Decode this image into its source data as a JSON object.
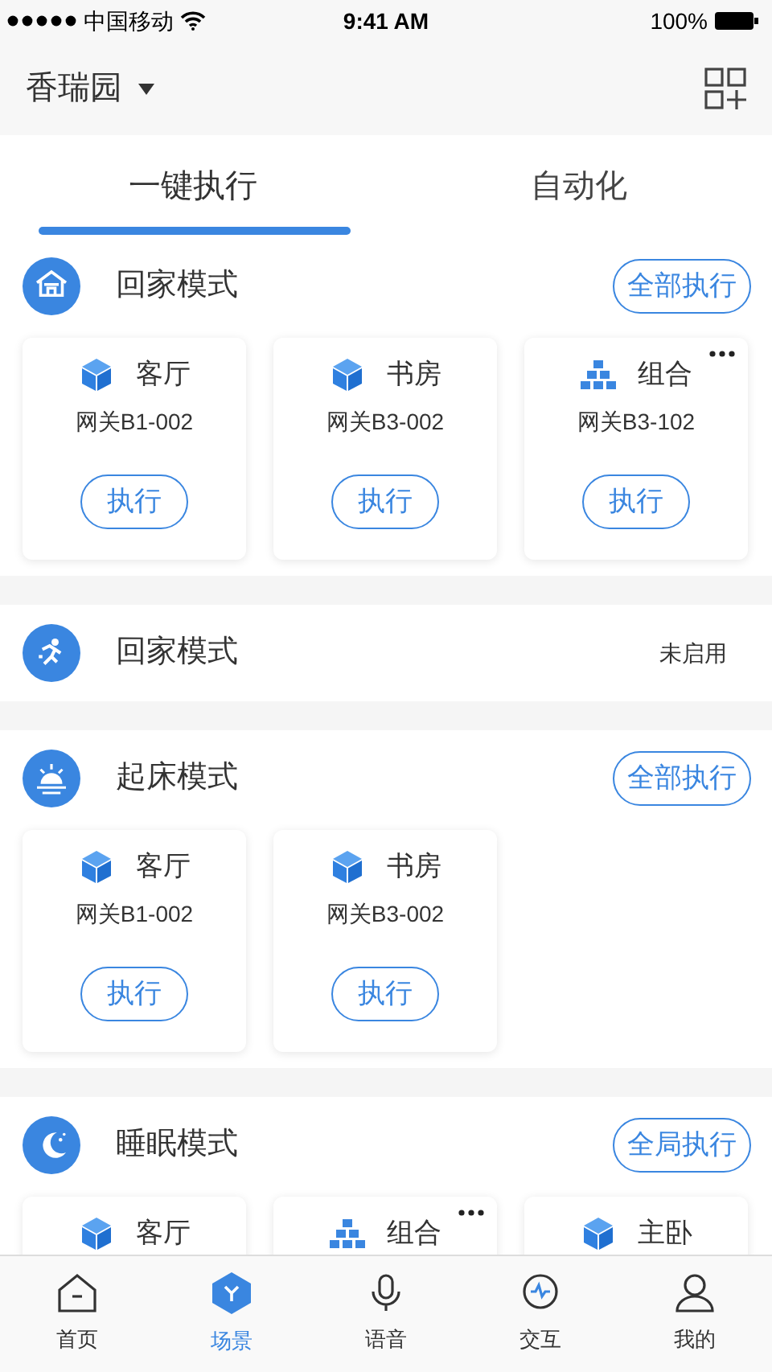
{
  "status_bar": {
    "carrier": "中国移动",
    "time": "9:41 AM",
    "battery": "100%"
  },
  "header": {
    "title": "香瑞园"
  },
  "tabs": [
    {
      "label": "一键执行",
      "selected": true
    },
    {
      "label": "自动化",
      "selected": false
    }
  ],
  "sections": [
    {
      "kind": "cards",
      "title": "回家模式",
      "action": "全部执行",
      "cards": [
        {
          "kind": "single",
          "title": "客厅",
          "gateway": "网关B1-002",
          "button": "执行",
          "more": false
        },
        {
          "kind": "single",
          "title": "书房",
          "gateway": "网关B3-002",
          "button": "执行",
          "more": false
        },
        {
          "kind": "group",
          "title": "组合",
          "gateway": "网关B3-102",
          "button": "执行",
          "more": true
        }
      ]
    },
    {
      "kind": "row",
      "title": "回家模式",
      "status": "未启用"
    },
    {
      "kind": "cards",
      "title": "起床模式",
      "action": "全部执行",
      "cards": [
        {
          "kind": "single",
          "title": "客厅",
          "gateway": "网关B1-002",
          "button": "执行",
          "more": false
        },
        {
          "kind": "single",
          "title": "书房",
          "gateway": "网关B3-002",
          "button": "执行",
          "more": false
        }
      ]
    },
    {
      "kind": "cards",
      "title": "睡眠模式",
      "action": "全局执行",
      "cards": [
        {
          "kind": "single",
          "title": "客厅",
          "more": false
        },
        {
          "kind": "group",
          "title": "组合",
          "more": true
        },
        {
          "kind": "single",
          "title": "主卧",
          "more": false
        }
      ]
    }
  ],
  "bottom_nav": [
    {
      "label": "首页",
      "selected": false
    },
    {
      "label": "场景",
      "selected": true
    },
    {
      "label": "语音",
      "selected": false
    },
    {
      "label": "交互",
      "selected": false
    },
    {
      "label": "我的",
      "selected": false
    }
  ]
}
